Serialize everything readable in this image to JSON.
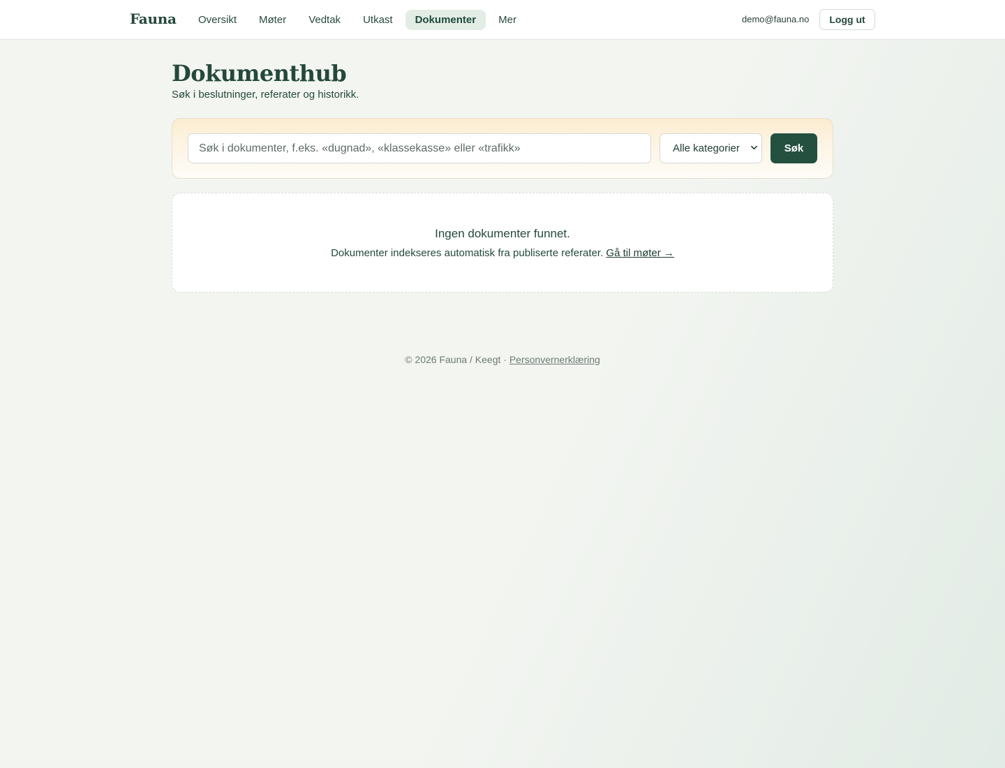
{
  "brand": {
    "name": "Fauna"
  },
  "nav": {
    "items": [
      {
        "label": "Oversikt",
        "active": false
      },
      {
        "label": "Møter",
        "active": false
      },
      {
        "label": "Vedtak",
        "active": false
      },
      {
        "label": "Utkast",
        "active": false
      },
      {
        "label": "Dokumenter",
        "active": true
      },
      {
        "label": "Mer",
        "active": false
      }
    ]
  },
  "user": {
    "email": "demo@fauna.no",
    "logout_label": "Logg ut"
  },
  "page": {
    "title": "Dokumenthub",
    "subtitle": "Søk i beslutninger, referater og historikk."
  },
  "search": {
    "placeholder": "Søk i dokumenter, f.eks. «dugnad», «klassekasse» eller «trafikk»",
    "value": "",
    "category_selected": "Alle kategorier",
    "button_label": "Søk"
  },
  "empty_state": {
    "title": "Ingen dokumenter funnet.",
    "description": "Dokumenter indekseres automatisk fra publiserte referater.",
    "link_label": "Gå til møter →"
  },
  "footer": {
    "copyright": "© 2026 Fauna / Keegt · ",
    "privacy_label": "Personvernerklæring"
  },
  "colors": {
    "accent": "#24503f",
    "active_nav_bg": "#e3ede6",
    "search_card_top": "#fbecd0"
  }
}
